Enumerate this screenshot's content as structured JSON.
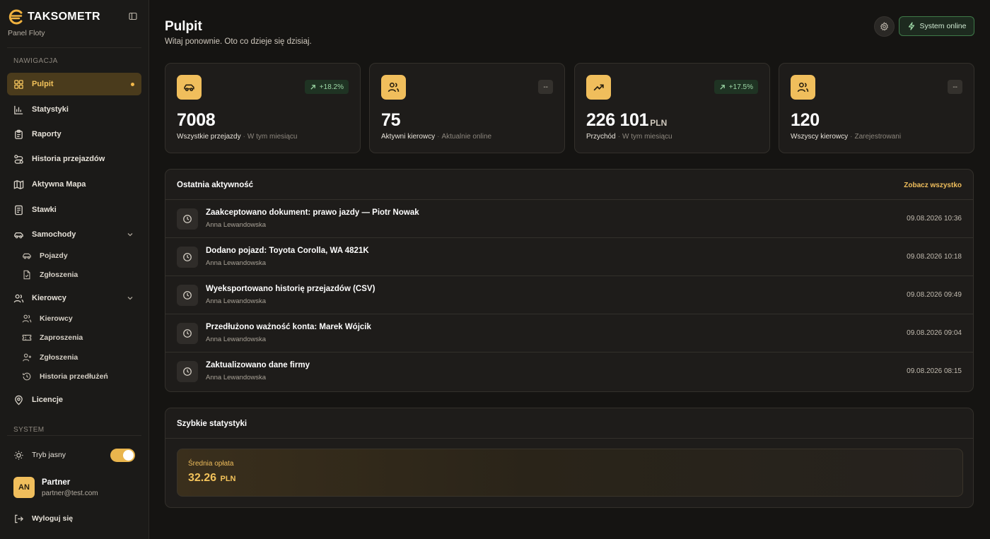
{
  "brand": {
    "name": "TAKSOMETR",
    "subtitle": "Panel Floty"
  },
  "sidebar": {
    "section_nav": "NAWIGACJA",
    "items": [
      {
        "label": "Pulpit",
        "icon": "dashboard-icon"
      },
      {
        "label": "Statystyki",
        "icon": "bar-chart-icon"
      },
      {
        "label": "Raporty",
        "icon": "clipboard-icon"
      },
      {
        "label": "Historia przejazdów",
        "icon": "route-icon"
      },
      {
        "label": "Aktywna Mapa",
        "icon": "map-icon"
      },
      {
        "label": "Stawki",
        "icon": "receipt-icon"
      },
      {
        "label": "Samochody",
        "icon": "car-icon"
      },
      {
        "label": "Kierowcy",
        "icon": "users-icon"
      },
      {
        "label": "Licencje",
        "icon": "map-pin-icon"
      }
    ],
    "cars_sub": [
      {
        "label": "Pojazdy",
        "icon": "car-icon"
      },
      {
        "label": "Zgłoszenia",
        "icon": "file-icon"
      }
    ],
    "drivers_sub": [
      {
        "label": "Kierowcy",
        "icon": "users-icon"
      },
      {
        "label": "Zaproszenia",
        "icon": "ticket-icon"
      },
      {
        "label": "Zgłoszenia",
        "icon": "user-plus-icon"
      },
      {
        "label": "Historia przedłużeń",
        "icon": "history-icon"
      }
    ],
    "section_system": "SYSTEM",
    "theme_toggle_label": "Tryb jasny",
    "theme_toggle_on": true,
    "user": {
      "initials": "AN",
      "name": "Partner",
      "email": "partner@test.com"
    },
    "logout_label": "Wyloguj się"
  },
  "header": {
    "title": "Pulpit",
    "subtitle": "Witaj ponownie. Oto co dzieje się dzisiaj.",
    "status_label": "System online"
  },
  "cards": [
    {
      "icon": "car-icon",
      "badge": "+18.2%",
      "badge_type": "up",
      "value": "7008",
      "unit": "",
      "label": "Wszystkie przejazdy",
      "extra": "W tym miesiącu"
    },
    {
      "icon": "users-icon",
      "badge": "--",
      "badge_type": "na",
      "value": "75",
      "unit": "",
      "label": "Aktywni kierowcy",
      "extra": "Aktualnie online"
    },
    {
      "icon": "trending-up-icon",
      "badge": "+17.5%",
      "badge_type": "up",
      "value": "226 101",
      "unit": "PLN",
      "label": "Przychód",
      "extra": "W tym miesiącu"
    },
    {
      "icon": "users-icon",
      "badge": "--",
      "badge_type": "na",
      "value": "120",
      "unit": "",
      "label": "Wszyscy kierowcy",
      "extra": "Zarejestrowani"
    }
  ],
  "activity": {
    "title": "Ostatnia aktywność",
    "see_all": "Zobacz wszystko",
    "rows": [
      {
        "title": "Zaakceptowano dokument: prawo jazdy — Piotr Nowak",
        "user": "Anna Lewandowska",
        "date": "09.08.2026 10:36"
      },
      {
        "title": "Dodano pojazd: Toyota Corolla, WA 4821K",
        "user": "Anna Lewandowska",
        "date": "09.08.2026 10:18"
      },
      {
        "title": "Wyeksportowano historię przejazdów (CSV)",
        "user": "Anna Lewandowska",
        "date": "09.08.2026 09:49"
      },
      {
        "title": "Przedłużono ważność konta: Marek Wójcik",
        "user": "Anna Lewandowska",
        "date": "09.08.2026 09:04"
      },
      {
        "title": "Zaktualizowano dane firmy",
        "user": "Anna Lewandowska",
        "date": "09.08.2026 08:15"
      }
    ]
  },
  "quick_stats": {
    "title": "Szybkie statystyki",
    "label": "Średnia opłata",
    "value": "32.26",
    "unit": "PLN"
  },
  "colors": {
    "accent": "#f0be5c",
    "background": "#151412",
    "card": "#1e1c1a",
    "success": "#3e7a48"
  }
}
